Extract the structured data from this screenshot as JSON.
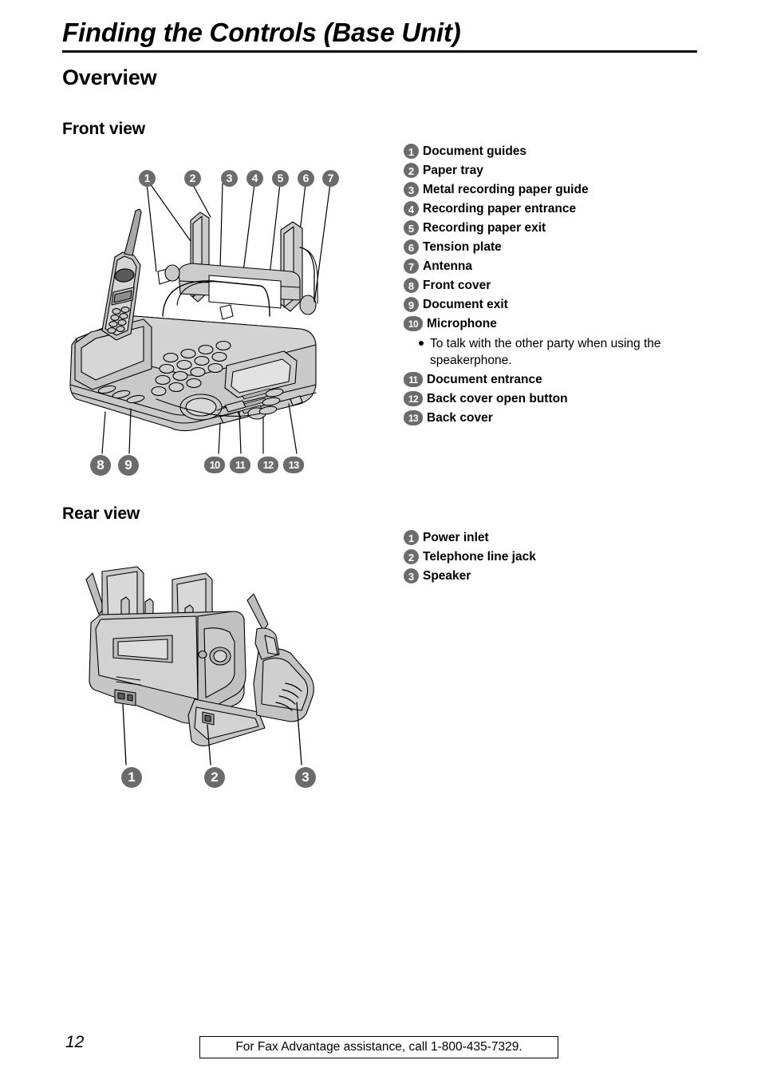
{
  "document": {
    "title": "Finding the Controls (Base Unit)",
    "section_heading": "Overview"
  },
  "front_view": {
    "heading": "Front view",
    "figure_callouts": [
      {
        "id": "1",
        "label": "1"
      },
      {
        "id": "2",
        "label": "2"
      },
      {
        "id": "3",
        "label": "3"
      },
      {
        "id": "4",
        "label": "4"
      },
      {
        "id": "5",
        "label": "5"
      },
      {
        "id": "6",
        "label": "6"
      },
      {
        "id": "7",
        "label": "7"
      },
      {
        "id": "8",
        "label": "8"
      },
      {
        "id": "9",
        "label": "9"
      },
      {
        "id": "10",
        "label": "10"
      },
      {
        "id": "11",
        "label": "11"
      },
      {
        "id": "12",
        "label": "12"
      },
      {
        "id": "13",
        "label": "13"
      }
    ],
    "items": [
      {
        "num": "1",
        "label": "Document guides"
      },
      {
        "num": "2",
        "label": "Paper tray"
      },
      {
        "num": "3",
        "label": "Metal recording paper guide"
      },
      {
        "num": "4",
        "label": "Recording paper entrance"
      },
      {
        "num": "5",
        "label": "Recording paper exit"
      },
      {
        "num": "6",
        "label": "Tension plate"
      },
      {
        "num": "7",
        "label": "Antenna"
      },
      {
        "num": "8",
        "label": "Front cover"
      },
      {
        "num": "9",
        "label": "Document exit"
      },
      {
        "num": "10",
        "label": "Microphone"
      },
      {
        "num": "11",
        "label": "Document entrance"
      },
      {
        "num": "12",
        "label": "Back cover open button"
      },
      {
        "num": "13",
        "label": "Back cover"
      }
    ],
    "microphone_note": "To talk with the other party when using the speakerphone."
  },
  "rear_view": {
    "heading": "Rear view",
    "figure_callouts": [
      {
        "id": "1",
        "label": "1"
      },
      {
        "id": "2",
        "label": "2"
      },
      {
        "id": "3",
        "label": "3"
      }
    ],
    "items": [
      {
        "num": "1",
        "label": "Power inlet"
      },
      {
        "num": "2",
        "label": "Telephone line jack"
      },
      {
        "num": "3",
        "label": "Speaker"
      }
    ]
  },
  "footer": {
    "page_number": "12",
    "notice": "For Fax Advantage assistance, call 1-800-435-7329."
  },
  "colors": {
    "badge_gray": "#6b6b6b",
    "artwork_fill": "#c8c8c8",
    "artwork_line": "#000000"
  }
}
